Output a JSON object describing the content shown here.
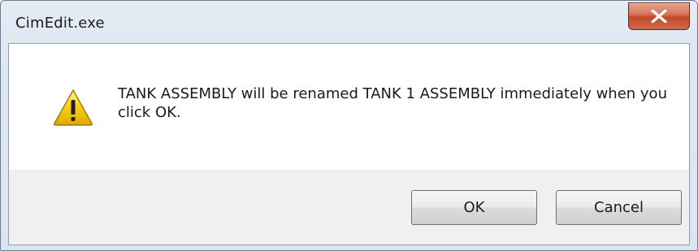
{
  "window": {
    "title": "CimEdit.exe"
  },
  "message": {
    "icon": "warning-icon",
    "text": "TANK ASSEMBLY will be renamed TANK 1 ASSEMBLY immediately when you click OK."
  },
  "buttons": {
    "ok_label": "OK",
    "cancel_label": "Cancel"
  },
  "colors": {
    "close_button": "#c7503a",
    "warning_fill": "#f5c400"
  }
}
